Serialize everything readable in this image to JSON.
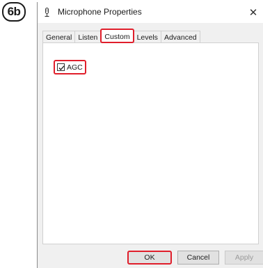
{
  "step_badge": "6b",
  "window": {
    "title": "Microphone Properties",
    "close_symbol": "✕",
    "icon": "microphone-icon"
  },
  "tabs": [
    {
      "label": "General",
      "active": false
    },
    {
      "label": "Listen",
      "active": false
    },
    {
      "label": "Custom",
      "active": true
    },
    {
      "label": "Levels",
      "active": false
    },
    {
      "label": "Advanced",
      "active": false
    }
  ],
  "custom_panel": {
    "agc": {
      "label": "AGC",
      "checked": true
    }
  },
  "buttons": {
    "ok": "OK",
    "cancel": "Cancel",
    "apply": "Apply"
  },
  "colors": {
    "highlight": "#e01e2b",
    "panel_bg": "#f0f0f0",
    "button_bg": "#e1e1e1"
  }
}
